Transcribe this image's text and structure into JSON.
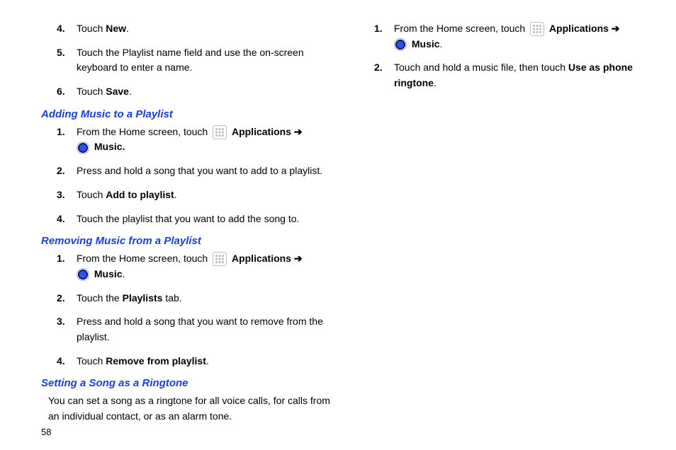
{
  "pageNumber": "58",
  "labels": {
    "applications": "Applications",
    "music": "Music",
    "arrow": "➔"
  },
  "col1": {
    "topSteps": [
      {
        "n": "4.",
        "pre": "Touch ",
        "bold": "New",
        "post": "."
      },
      {
        "n": "5.",
        "plain": "Touch the Playlist name field and use the on-screen keyboard to enter a name."
      },
      {
        "n": "6.",
        "pre": "Touch ",
        "bold": "Save",
        "post": "."
      }
    ],
    "sectionA": "Adding Music to a Playlist",
    "addSteps": [
      {
        "n": "1.",
        "pre": "From the Home screen, touch ",
        "hasIcons": true,
        "musicBoldDot": true
      },
      {
        "n": "2.",
        "plain": "Press and hold a song that you want to add to a playlist."
      },
      {
        "n": "3.",
        "pre": "Touch ",
        "bold": "Add to playlist",
        "post": "."
      },
      {
        "n": "4.",
        "plain": "Touch the playlist that you want to add the song to."
      }
    ],
    "sectionB": "Removing Music from a Playlist",
    "remSteps": [
      {
        "n": "1.",
        "pre": "From the Home screen, touch ",
        "hasIcons": true
      },
      {
        "n": "2.",
        "pre": "Touch the ",
        "bold": "Playlists",
        "post": " tab."
      },
      {
        "n": "3.",
        "plain": "Press and hold a song that you want to remove from the playlist."
      },
      {
        "n": "4.",
        "pre": "Touch ",
        "bold": "Remove from playlist",
        "post": "."
      }
    ],
    "sectionC": "Setting a Song as a Ringtone",
    "ringPara": "You can set a song as a ringtone for all voice calls, for calls from an individual contact, or as an alarm tone."
  },
  "col2": {
    "steps": [
      {
        "n": "1.",
        "pre": "From the Home screen, touch ",
        "hasIcons": true
      },
      {
        "n": "2.",
        "pre": "Touch and hold a music file, then touch ",
        "bold": "Use as phone ringtone",
        "post": "."
      }
    ]
  }
}
